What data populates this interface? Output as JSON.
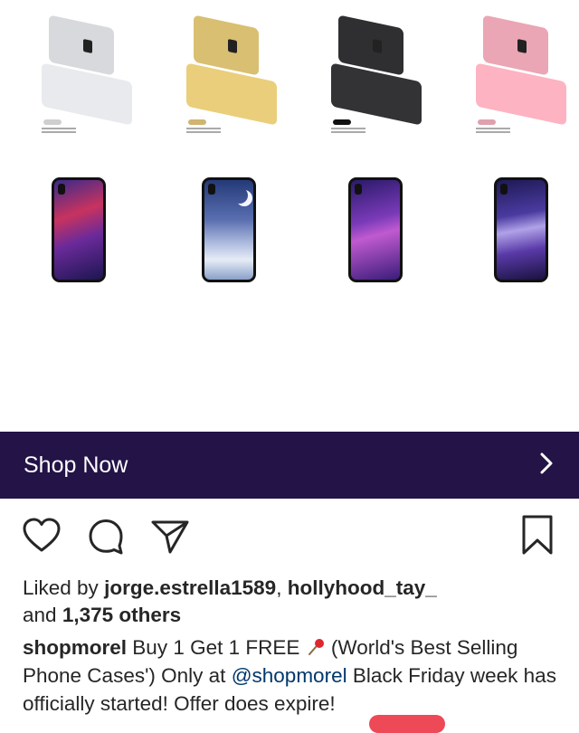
{
  "colors": {
    "banner_bg": "#231347",
    "banner_text": "#ffffff",
    "text": "#262626",
    "mention": "#00376b",
    "accent_red": "#ed4956"
  },
  "product_image": {
    "flip_cases": [
      {
        "color": "#d8d9dc",
        "tag_color": "#cfcfcf"
      },
      {
        "color": "#d9bf72",
        "tag_color": "#d0b470"
      },
      {
        "color": "#2f2f31",
        "tag_color": "#111111"
      },
      {
        "color": "#eaa6b4",
        "tag_color": "#e0a0ad"
      }
    ],
    "galaxy_cases": [
      {
        "gradient": "linear-gradient(160deg,#3a2a8c 0%,#c8335f 35%,#6a2a9a 60%,#1c1650 100%)"
      },
      {
        "gradient": "linear-gradient(180deg,#243a78 0%,#5a6fb0 40%,#a9b7dc 62%,#e6ecf6 80%,#8aa0c8 100%)"
      },
      {
        "gradient": "linear-gradient(165deg,#2a1a6a 0%,#7a3ab8 40%,#c05ad0 55%,#3a1d7a 100%)"
      },
      {
        "gradient": "linear-gradient(170deg,#1e1a55 0%,#4a3aa0 35%,#b0a2e8 50%,#5a3aa8 70%,#1a1240 100%)"
      }
    ]
  },
  "shop_now": {
    "label": "Shop Now",
    "icon": "chevron-right-icon"
  },
  "actions": {
    "like_icon": "heart-icon",
    "comment_icon": "comment-icon",
    "share_icon": "send-icon",
    "save_icon": "bookmark-icon"
  },
  "likes": {
    "prefix": "Liked by",
    "user1": "jorge.estrella1589",
    "separator": ",",
    "user2": "hollyhood_tay_",
    "conjunction": "and",
    "count": "1,375 others"
  },
  "caption": {
    "username": "shopmorel",
    "text_before_pin": "Buy 1 Get 1 FREE",
    "pin_icon": "pushpin-icon",
    "text_after_pin": "(World's Best Selling Phone Cases') Only at",
    "mention": "@shopmorel",
    "text_end": "Black Friday week has officially started! Offer does expire!"
  }
}
